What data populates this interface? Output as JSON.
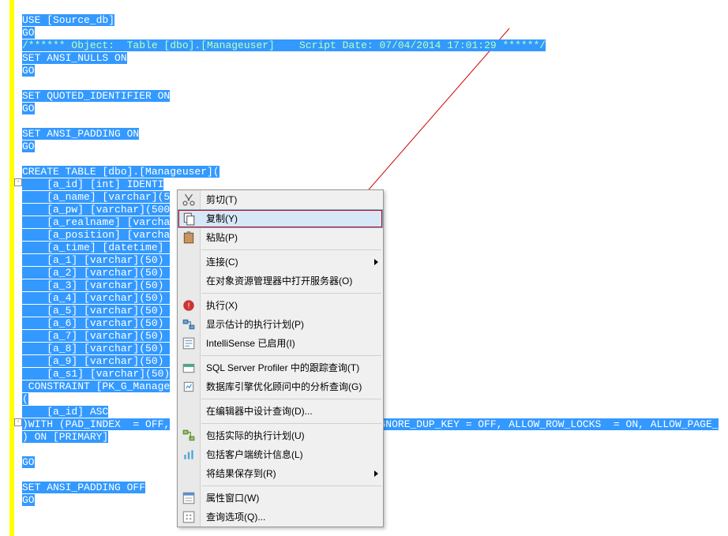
{
  "sql": {
    "l1": "USE [Source_db]",
    "l2": "GO",
    "l3": "/****** Object:  Table [dbo].[Manageuser]    Script Date: 07/04/2014 17:01:29 ******/",
    "l4": "SET ANSI_NULLS ON",
    "l5": "GO",
    "l6": "SET QUOTED_IDENTIFIER ON",
    "l7": "GO",
    "l8": "SET ANSI_PADDING ON",
    "l9": "GO",
    "l10": "CREATE TABLE [dbo].[Manageuser](",
    "l11": "    [a_id] [int] IDENTI",
    "l12": "    [a_name] [varchar](5",
    "l13": "    [a_pw] [varchar](500",
    "l14": "    [a_realname] [varcha",
    "l15": "    [a_position] [varcha",
    "l16": "    [a_time] [datetime] ",
    "l17": "    [a_1] [varchar](50) ",
    "l18": "    [a_2] [varchar](50) ",
    "l19": "    [a_3] [varchar](50) ",
    "l20": "    [a_4] [varchar](50) ",
    "l21": "    [a_5] [varchar](50) ",
    "l22": "    [a_6] [varchar](50) ",
    "l23": "    [a_7] [varchar](50) ",
    "l24": "    [a_8] [varchar](50) ",
    "l25": "    [a_9] [varchar](50) ",
    "l26": "    [a_s1] [varchar](50)",
    "l27": " CONSTRAINT [PK_G_Manage",
    "l28": "(",
    "l29": "    [a_id] ASC",
    "l30a": ")WITH (PAD_INDEX  = OFF,",
    "l30b": "GNORE_DUP_KEY = OFF, ALLOW_ROW_LOCKS  = ON, ALLOW_PAGE_",
    "l31": ") ON [PRIMARY]",
    "l32": "GO",
    "l33": "SET ANSI_PADDING OFF",
    "l34": "GO"
  },
  "menu": {
    "cut": "剪切(T)",
    "copy": "复制(Y)",
    "paste": "粘贴(P)",
    "connect": "连接(C)",
    "open_in_oe": "在对象资源管理器中打开服务器(O)",
    "execute": "执行(X)",
    "est_plan": "显示估计的执行计划(P)",
    "intellisense": "IntelliSense 已启用(I)",
    "profiler": "SQL Server Profiler 中的跟踪查询(T)",
    "tuning": "数据库引擎优化顾问中的分析查询(G)",
    "design": "在编辑器中设计查询(D)...",
    "actual_plan": "包括实际的执行计划(U)",
    "client_stats": "包括客户端统计信息(L)",
    "save_results": "将结果保存到(R)",
    "prop_window": "属性窗口(W)",
    "query_opts": "查询选项(Q)..."
  }
}
